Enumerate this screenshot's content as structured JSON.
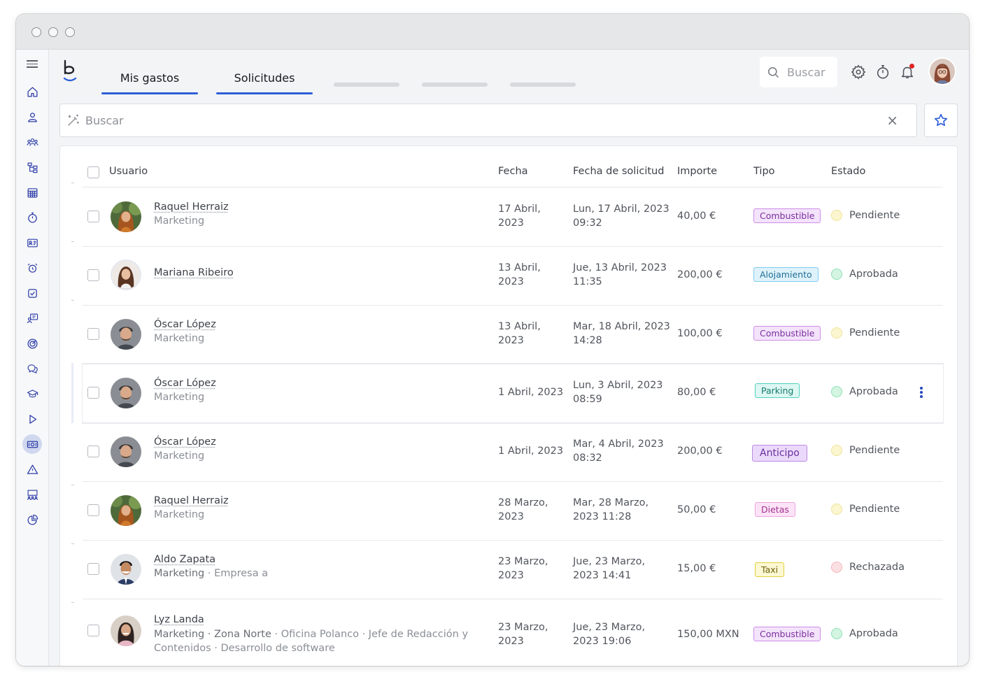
{
  "window": {
    "controls": [
      "close",
      "minimize",
      "maximize"
    ]
  },
  "sidebar": {
    "items": [
      {
        "icon": "home-icon"
      },
      {
        "icon": "user-icon"
      },
      {
        "icon": "team-icon"
      },
      {
        "icon": "org-chart-icon"
      },
      {
        "icon": "calendar-grid-icon"
      },
      {
        "icon": "stopwatch-icon"
      },
      {
        "icon": "id-card-icon"
      },
      {
        "icon": "alarm-icon"
      },
      {
        "icon": "checklist-icon"
      },
      {
        "icon": "user-board-icon"
      },
      {
        "icon": "target-icon"
      },
      {
        "icon": "chat-icon"
      },
      {
        "icon": "graduation-icon"
      },
      {
        "icon": "play-icon"
      },
      {
        "icon": "money-icon",
        "active": true
      },
      {
        "icon": "warning-icon"
      },
      {
        "icon": "meeting-icon"
      },
      {
        "icon": "pie-chart-icon"
      }
    ]
  },
  "header": {
    "tabs": [
      {
        "label": "Mis gastos",
        "active": true
      },
      {
        "label": "Solicitudes",
        "active": true
      }
    ],
    "search_placeholder": "Buscar",
    "icons": [
      "gear-icon",
      "stopwatch-icon",
      "bell-icon"
    ],
    "has_notification": true
  },
  "filter": {
    "placeholder": "Buscar",
    "clear_label": "×"
  },
  "table": {
    "columns": {
      "user": "Usuario",
      "date": "Fecha",
      "request_date": "Fecha de solicitud",
      "amount": "Importe",
      "type": "Tipo",
      "status": "Estado"
    },
    "rows": [
      {
        "name": "Raquel Herraiz",
        "sub": "Marketing",
        "date1": "17 Abril,",
        "date2": "2023",
        "req1": "Lun, 17 Abril, 2023",
        "req2": "09:32",
        "amount": "40,00 €",
        "type": "Combustible",
        "status": "Pendiente"
      },
      {
        "name": "Mariana Ribeiro",
        "sub": "",
        "date1": "13 Abril,",
        "date2": "2023",
        "req1": "Jue, 13 Abril, 2023",
        "req2": "11:35",
        "amount": "200,00 €",
        "type": "Alojamiento",
        "status": "Aprobada"
      },
      {
        "name": "Óscar López",
        "sub": "Marketing",
        "date1": "13 Abril,",
        "date2": "2023",
        "req1": "Mar, 18 Abril, 2023",
        "req2": "14:28",
        "amount": "100,00 €",
        "type": "Combustible",
        "status": "Pendiente"
      },
      {
        "name": "Óscar López",
        "sub": "Marketing",
        "date1": "1 Abril, 2023",
        "date2": "",
        "req1": "Lun, 3 Abril, 2023",
        "req2": "08:59",
        "amount": "80,00 €",
        "type": "Parking",
        "status": "Aprobada"
      },
      {
        "name": "Óscar López",
        "sub": "Marketing",
        "date1": "1 Abril, 2023",
        "date2": "",
        "req1": "Mar, 4 Abril, 2023",
        "req2": "08:32",
        "amount": "200,00 €",
        "type": "Anticipo",
        "status": "Pendiente"
      },
      {
        "name": "Raquel Herraiz",
        "sub": "Marketing",
        "date1": "28 Marzo,",
        "date2": "2023",
        "req1": "Mar, 28 Marzo,",
        "req2": "2023 11:28",
        "amount": "50,00 €",
        "type": "Dietas",
        "status": "Pendiente"
      },
      {
        "name": "Aldo Zapata",
        "sub_bold": "Marketing",
        "sub_rest": " · Empresa a",
        "date1": "23 Marzo,",
        "date2": "2023",
        "req1": "Jue, 23 Marzo,",
        "req2": "2023 14:41",
        "amount": "15,00 €",
        "type": "Taxi",
        "status": "Rechazada"
      },
      {
        "name": "Lyz Landa",
        "sub_line1_a": "Marketing · ",
        "sub_line1_b": "Zona Norte",
        "sub_line1_c": " · Oficina Polanco · Jefe de Redacción y",
        "sub_line2": "Contenidos · Desarrollo de software",
        "date1": "23 Marzo,",
        "date2": "2023",
        "req1": "Jue, 23 Marzo,",
        "req2": "2023 19:06",
        "amount": "150,00 MXN",
        "type": "Combustible",
        "status": "Aprobada"
      }
    ]
  },
  "colors": {
    "accent": "#2e5fd8",
    "badge_combustible": "#b561d6",
    "badge_alojamiento": "#3aa6df",
    "badge_parking": "#1fb3a0",
    "badge_anticipo": "#a262d7",
    "badge_dietas": "#e07ad3",
    "badge_taxi": "#d8c01e",
    "status_pendiente": "#f3e68c",
    "status_aprobada": "#8fe0b6",
    "status_rechazada": "#f3b6bd"
  }
}
